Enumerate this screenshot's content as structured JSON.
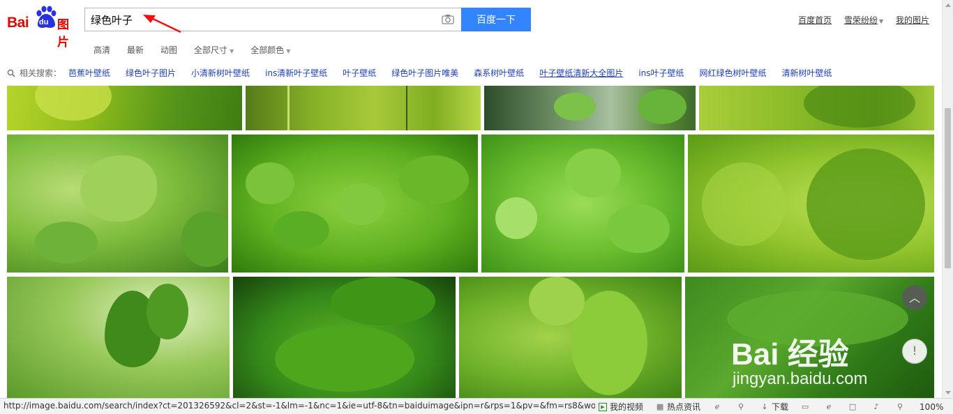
{
  "logo": {
    "bai": "Bai",
    "du": "du",
    "tu": "图片"
  },
  "search": {
    "value": "绿色叶子",
    "button": "百度一下"
  },
  "top_links": {
    "home": "百度首页",
    "user": "雪荣纷纷",
    "mine": "我的图片"
  },
  "filters": [
    "高清",
    "最新",
    "动图",
    "全部尺寸",
    "全部颜色"
  ],
  "related": {
    "label": "相关搜索：",
    "items": [
      "芭蕉叶壁纸",
      "绿色叶子图片",
      "小清新树叶壁纸",
      "ins清新叶子壁纸",
      "叶子壁纸",
      "绿色叶子图片唯美",
      "森系树叶壁纸",
      "叶子壁纸清新大全图片",
      "ins叶子壁纸",
      "网红绿色树叶壁纸",
      "清新树叶壁纸"
    ]
  },
  "watermark": {
    "brand": "Bai 经验",
    "url": "jingyan.baidu.com"
  },
  "float": {
    "top": "︿",
    "feedback": "!"
  },
  "statusbar": {
    "url": "http://image.baidu.com/search/index?ct=201326592&cl=2&st=-1&lm=-1&nc=1&ie=utf-8&tn=baiduimage&ipn=r&rps=1&pv=&fm=rs8&word=%",
    "video": "我的视频",
    "hot": "热点资讯",
    "download": "下载",
    "zoom": "100%"
  },
  "colors": {
    "accent": "#3385ff",
    "brand": "#e10602",
    "link": "#1e40b5"
  }
}
